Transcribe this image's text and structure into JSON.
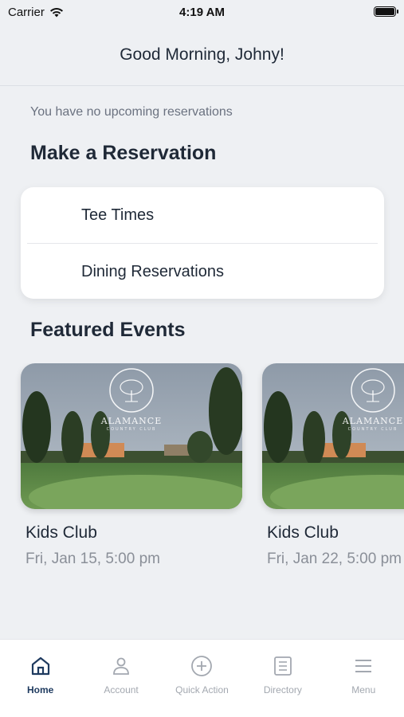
{
  "status_bar": {
    "carrier": "Carrier",
    "time": "4:19 AM"
  },
  "header": {
    "greeting": "Good Morning, Johny!"
  },
  "reservations": {
    "empty_text": "You have no upcoming reservations",
    "section_title": "Make a Reservation",
    "items": [
      {
        "label": "Tee Times"
      },
      {
        "label": "Dining Reservations"
      }
    ]
  },
  "featured": {
    "section_title": "Featured Events",
    "logo_text": "ALAMANCE",
    "logo_sub": "COUNTRY CLUB",
    "events": [
      {
        "title": "Kids Club",
        "date": "Fri, Jan 15, 5:00 pm"
      },
      {
        "title": "Kids Club",
        "date": "Fri, Jan 22, 5:00 pm"
      }
    ]
  },
  "tabbar": {
    "tabs": [
      {
        "label": "Home",
        "icon": "home-icon",
        "active": true
      },
      {
        "label": "Account",
        "icon": "account-icon",
        "active": false
      },
      {
        "label": "Quick Action",
        "icon": "plus-circle-icon",
        "active": false
      },
      {
        "label": "Directory",
        "icon": "directory-icon",
        "active": false
      },
      {
        "label": "Menu",
        "icon": "menu-icon",
        "active": false
      }
    ],
    "active_color": "#1e3a5f",
    "inactive_color": "#a3a8b0"
  }
}
